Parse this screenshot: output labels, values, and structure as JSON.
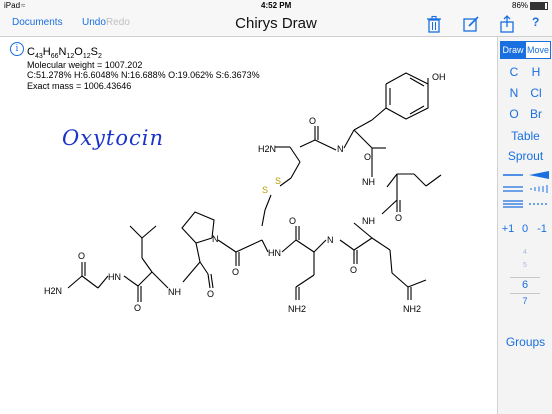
{
  "status": {
    "device": "iPad",
    "wifi": "wifi-icon",
    "time": "4:52 PM",
    "battery": "86%"
  },
  "toolbar": {
    "documents": "Documents",
    "undo": "Undo",
    "redo": "Redo",
    "title": "Chirys Draw",
    "question": "?"
  },
  "info": {
    "formula": {
      "C": "C",
      "C_n": "43",
      "H": "H",
      "H_n": "66",
      "N": "N",
      "N_n": "12",
      "O": "O",
      "O_n": "12",
      "S": "S",
      "S_n": "2"
    },
    "mw": "Molecular weight = 1007.202",
    "composition": "C:51.278% H:6.6048% N:16.688% O:19.062% S:6.3673%",
    "mass": "Exact mass = 1006.43646"
  },
  "drawing": {
    "name": "Oxytocin",
    "labels": {
      "oh": "OH",
      "h2n_top": "H2N",
      "s1": "S",
      "s2": "S",
      "h2n_left": "H2N",
      "nh2_mid": "NH2",
      "nh2_right": "NH2",
      "n": "N",
      "nh": "NH",
      "hn": "HN",
      "o": "O"
    }
  },
  "panel": {
    "mode_draw": "Draw",
    "mode_move": "Move",
    "atoms": [
      "C",
      "H",
      "N",
      "Cl",
      "O",
      "Br"
    ],
    "table": "Table",
    "sprout": "Sprout",
    "charges": [
      "+1",
      "0",
      "-1"
    ],
    "ring_sizes": [
      "4",
      "5",
      "6",
      "7"
    ],
    "groups": "Groups"
  }
}
